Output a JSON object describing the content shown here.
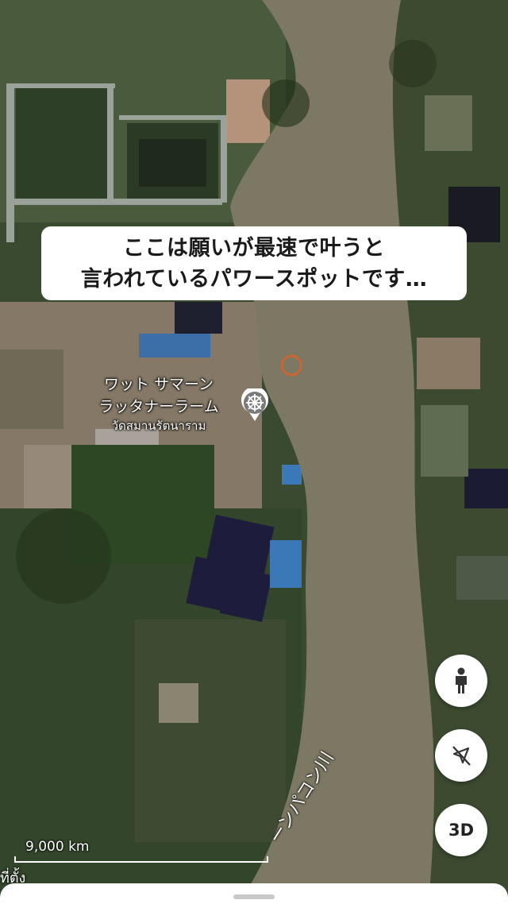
{
  "caption": {
    "line1": "ここは願いが最速で叶うと",
    "line2": "言われているパワースポットです…"
  },
  "place": {
    "name_line1": "ワット サマーン",
    "name_line2": "ラッタナーラーム",
    "name_thai": "วัดสมานรัตนาราม"
  },
  "controls": {
    "person_icon": "person-icon",
    "compass_icon": "compass-off-icon",
    "three_d_label": "3D"
  },
  "scale": {
    "label": "9,000 km"
  },
  "corner_label": "ที่ตั้ง",
  "river_label": "ーンパコン川",
  "colors": {
    "river": "#7a7560",
    "vegetation": "#3b4a2f",
    "ponds": "#1f1d3a",
    "caption_bg": "#ffffff"
  }
}
